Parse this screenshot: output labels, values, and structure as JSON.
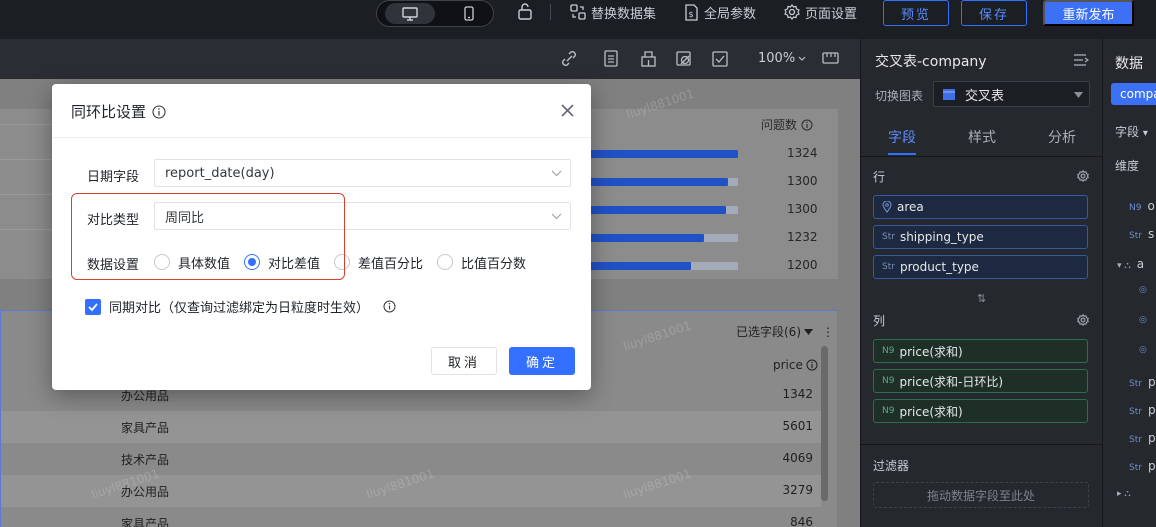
{
  "topbar": {
    "replace_dataset": "替换数据集",
    "global_params": "全局参数",
    "page_settings": "页面设置",
    "preview": "预览",
    "save": "保存",
    "republish": "重新发布"
  },
  "canvas_toolbar": {
    "zoom": "100%"
  },
  "canvas": {
    "card1": {
      "column_title": "问题数",
      "bars": [
        {
          "value": "1324",
          "fill": 1.0
        },
        {
          "value": "1300",
          "fill": 0.935
        },
        {
          "value": "1300",
          "fill": 0.92
        },
        {
          "value": "1232",
          "fill": 0.77
        },
        {
          "value": "1200",
          "fill": 0.68
        }
      ]
    },
    "card2": {
      "selected_fields": "已选字段(6)",
      "column_header": "price",
      "rows": [
        {
          "name": "办公用品",
          "value": "1342"
        },
        {
          "name": "家具产品",
          "value": "5601"
        },
        {
          "name": "技术产品",
          "value": "4069"
        },
        {
          "name": "办公用品",
          "value": "3279"
        },
        {
          "name": "家具产品",
          "value": "846"
        }
      ]
    },
    "watermark": "liuyl881001"
  },
  "properties": {
    "title": "交叉表-company",
    "switch_chart_label": "切换图表",
    "chart_type": "交叉表",
    "tabs": [
      "字段",
      "样式",
      "分析"
    ],
    "rows_section": "行",
    "row_fields": [
      {
        "tag": "",
        "name": "area"
      },
      {
        "tag": "Str",
        "name": "shipping_type"
      },
      {
        "tag": "Str",
        "name": "product_type"
      }
    ],
    "columns_section": "列",
    "column_fields": [
      {
        "tag": "N9",
        "name": "price(求和)"
      },
      {
        "tag": "N9",
        "name": "price(求和-日环比)"
      },
      {
        "tag": "N9",
        "name": "price(求和)"
      }
    ],
    "filter_section": "过滤器",
    "filter_placeholder": "拖动数据字段至此处"
  },
  "data_panel": {
    "title": "数据",
    "dataset": "compa",
    "fields_label": "字段",
    "dimension_label": "维度",
    "items": [
      {
        "tag": "N9",
        "name": "o"
      },
      {
        "tag": "Str",
        "name": "s"
      },
      {
        "tag": "",
        "name": "a"
      },
      {
        "tag": "Str",
        "name": "p"
      },
      {
        "tag": "Str",
        "name": "p"
      },
      {
        "tag": "Str",
        "name": "p"
      },
      {
        "tag": "Str",
        "name": "p"
      }
    ]
  },
  "modal": {
    "title": "同环比设置",
    "date_field_label": "日期字段",
    "date_field_value": "report_date(day)",
    "compare_type_label": "对比类型",
    "compare_type_value": "周同比",
    "data_setting_label": "数据设置",
    "options": [
      "具体数值",
      "对比差值",
      "差值百分比",
      "比值百分数"
    ],
    "selected_option": "对比差值",
    "same_period_label": "同期对比（仅查询过滤绑定为日粒度时生效）",
    "same_period_checked": true,
    "cancel": "取消",
    "ok": "确定"
  },
  "colors": {
    "accent": "#3370ff",
    "highlight": "#d9402b"
  }
}
